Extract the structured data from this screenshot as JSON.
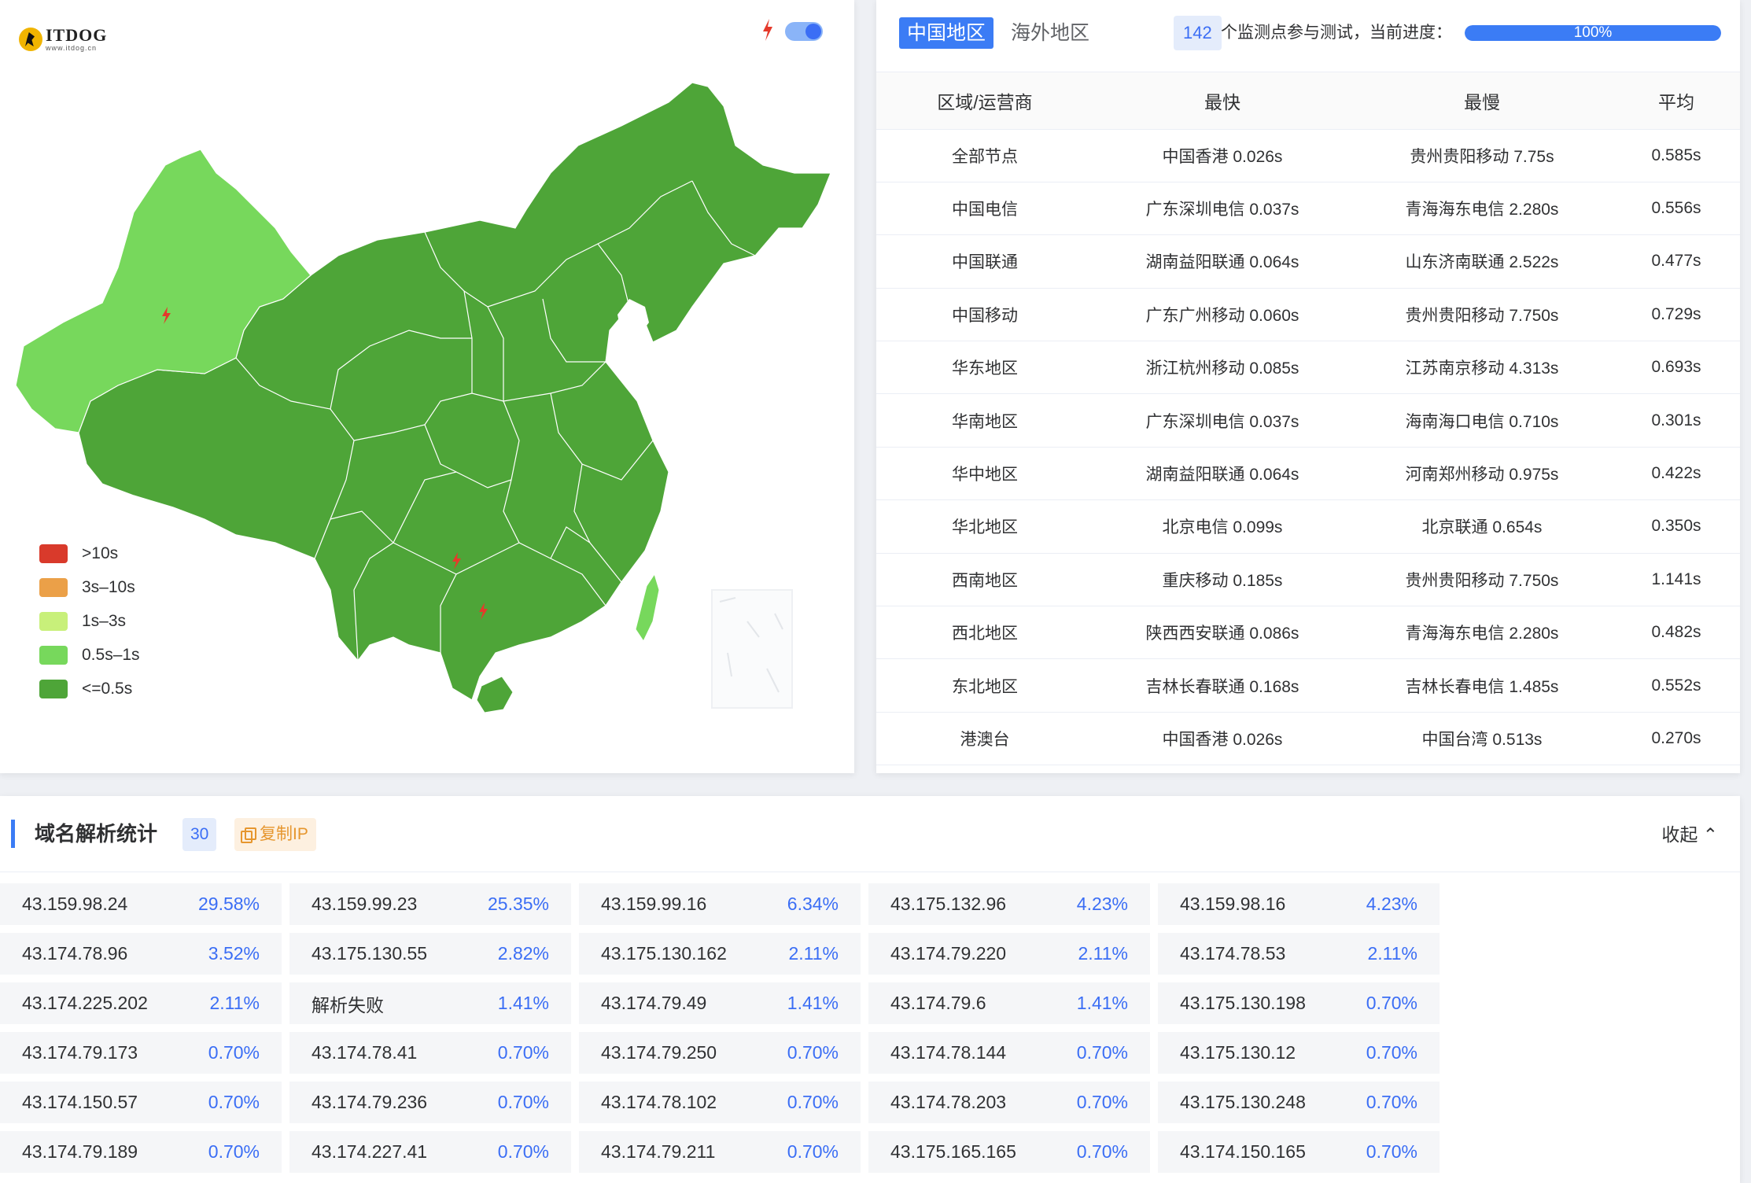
{
  "logo": {
    "name": "ITDOG",
    "url": "www.itdog.cn"
  },
  "legend": [
    {
      "label": ">10s",
      "color": "#d93a2b"
    },
    {
      "label": "3s–10s",
      "color": "#eba048"
    },
    {
      "label": "1s–3s",
      "color": "#c8f07a"
    },
    {
      "label": "0.5s–1s",
      "color": "#77d85c"
    },
    {
      "label": "<=0.5s",
      "color": "#4ea538"
    }
  ],
  "colors": {
    "accent": "#3b7cf5",
    "fast": "#4ea538",
    "medium": "#77d85c",
    "alert": "#d93a2b"
  },
  "tabs": {
    "active": "中国地区",
    "inactive": "海外地区"
  },
  "monitor": {
    "count": "142",
    "text": "个监测点参与测试，当前进度：",
    "progress_label": "100%",
    "progress": 100
  },
  "table": {
    "headers": [
      "区域/运营商",
      "最快",
      "最慢",
      "平均"
    ],
    "rows": [
      [
        "全部节点",
        "中国香港 0.026s",
        "贵州贵阳移动 7.75s",
        "0.585s"
      ],
      [
        "中国电信",
        "广东深圳电信 0.037s",
        "青海海东电信 2.280s",
        "0.556s"
      ],
      [
        "中国联通",
        "湖南益阳联通 0.064s",
        "山东济南联通 2.522s",
        "0.477s"
      ],
      [
        "中国移动",
        "广东广州移动 0.060s",
        "贵州贵阳移动 7.750s",
        "0.729s"
      ],
      [
        "华东地区",
        "浙江杭州移动 0.085s",
        "江苏南京移动 4.313s",
        "0.693s"
      ],
      [
        "华南地区",
        "广东深圳电信 0.037s",
        "海南海口电信 0.710s",
        "0.301s"
      ],
      [
        "华中地区",
        "湖南益阳联通 0.064s",
        "河南郑州移动 0.975s",
        "0.422s"
      ],
      [
        "华北地区",
        "北京电信 0.099s",
        "北京联通 0.654s",
        "0.350s"
      ],
      [
        "西南地区",
        "重庆移动 0.185s",
        "贵州贵阳移动 7.750s",
        "1.141s"
      ],
      [
        "西北地区",
        "陕西西安联通 0.086s",
        "青海海东电信 2.280s",
        "0.482s"
      ],
      [
        "东北地区",
        "吉林长春联通 0.168s",
        "吉林长春电信 1.485s",
        "0.552s"
      ],
      [
        "港澳台",
        "中国香港 0.026s",
        "中国台湾 0.513s",
        "0.270s"
      ]
    ]
  },
  "dns": {
    "title": "域名解析统计",
    "count": "30",
    "copy_label": "复制IP",
    "collapse_label": "收起 ⌃",
    "items": [
      {
        "ip": "43.159.98.24",
        "pct": "29.58%"
      },
      {
        "ip": "43.159.99.23",
        "pct": "25.35%"
      },
      {
        "ip": "43.159.99.16",
        "pct": "6.34%"
      },
      {
        "ip": "43.175.132.96",
        "pct": "4.23%"
      },
      {
        "ip": "43.159.98.16",
        "pct": "4.23%"
      },
      {
        "ip": "43.174.78.96",
        "pct": "3.52%"
      },
      {
        "ip": "43.175.130.55",
        "pct": "2.82%"
      },
      {
        "ip": "43.175.130.162",
        "pct": "2.11%"
      },
      {
        "ip": "43.174.79.220",
        "pct": "2.11%"
      },
      {
        "ip": "43.174.78.53",
        "pct": "2.11%"
      },
      {
        "ip": "43.174.225.202",
        "pct": "2.11%"
      },
      {
        "ip": "解析失败",
        "pct": "1.41%"
      },
      {
        "ip": "43.174.79.49",
        "pct": "1.41%"
      },
      {
        "ip": "43.174.79.6",
        "pct": "1.41%"
      },
      {
        "ip": "43.175.130.198",
        "pct": "0.70%"
      },
      {
        "ip": "43.174.79.173",
        "pct": "0.70%"
      },
      {
        "ip": "43.174.78.41",
        "pct": "0.70%"
      },
      {
        "ip": "43.174.79.250",
        "pct": "0.70%"
      },
      {
        "ip": "43.174.78.144",
        "pct": "0.70%"
      },
      {
        "ip": "43.175.130.12",
        "pct": "0.70%"
      },
      {
        "ip": "43.174.150.57",
        "pct": "0.70%"
      },
      {
        "ip": "43.174.79.236",
        "pct": "0.70%"
      },
      {
        "ip": "43.174.78.102",
        "pct": "0.70%"
      },
      {
        "ip": "43.174.78.203",
        "pct": "0.70%"
      },
      {
        "ip": "43.175.130.248",
        "pct": "0.70%"
      },
      {
        "ip": "43.174.79.189",
        "pct": "0.70%"
      },
      {
        "ip": "43.174.227.41",
        "pct": "0.70%"
      },
      {
        "ip": "43.174.79.211",
        "pct": "0.70%"
      },
      {
        "ip": "43.175.165.165",
        "pct": "0.70%"
      },
      {
        "ip": "43.174.150.165",
        "pct": "0.70%"
      }
    ]
  }
}
